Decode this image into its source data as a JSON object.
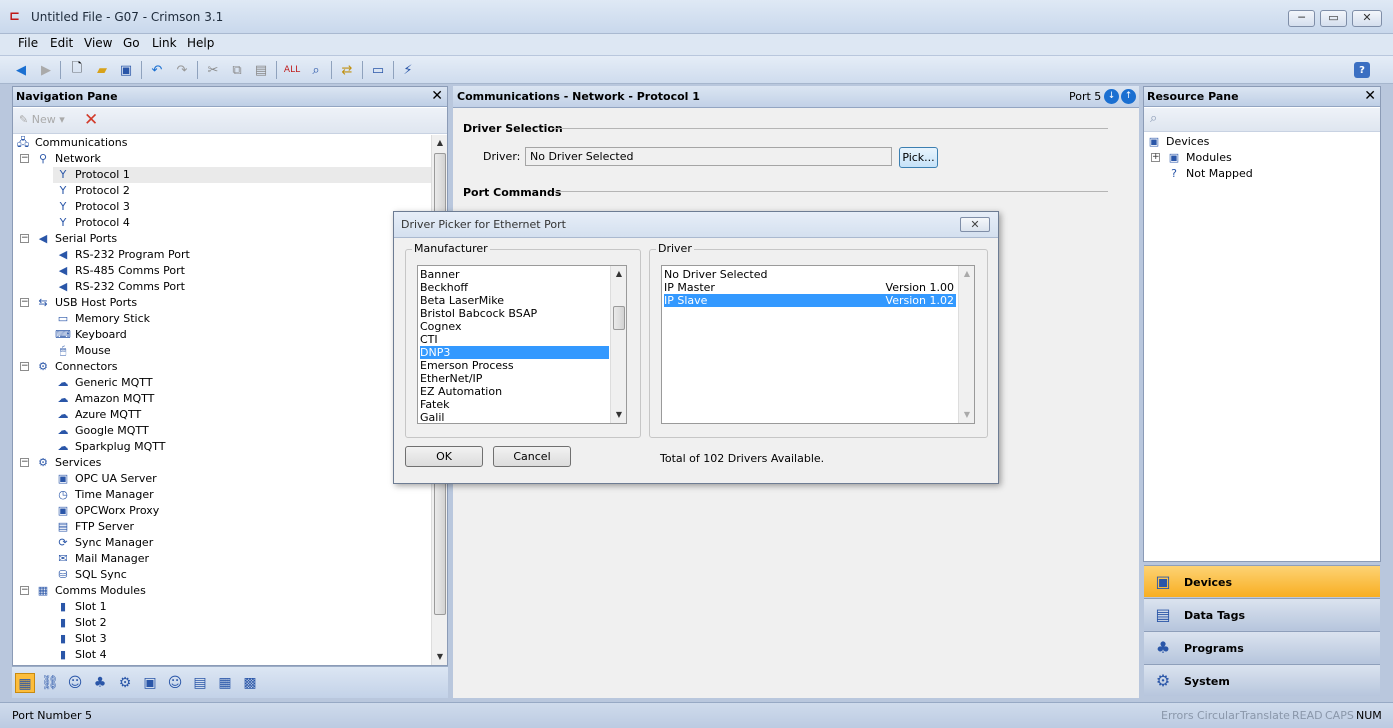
{
  "window": {
    "title": "Untitled File - G07 - Crimson 3.1",
    "min": "─",
    "max": "▭",
    "close": "✕"
  },
  "menu": [
    "File",
    "Edit",
    "View",
    "Go",
    "Link",
    "Help"
  ],
  "toolbar_icons": [
    "back-icon",
    "forward-icon",
    "new-file-icon",
    "open-folder-icon",
    "save-icon",
    "undo-icon",
    "redo-icon",
    "cut-icon",
    "copy-icon",
    "paste-icon",
    "find-all-icon",
    "find-icon",
    "link-icon",
    "monitor-icon",
    "wand-icon",
    "help-icon"
  ],
  "nav": {
    "title": "Navigation Pane",
    "new_label": "New ▾",
    "tree": [
      {
        "label": "Communications",
        "level": 0,
        "icon": "🖧"
      },
      {
        "label": "Network",
        "level": 1,
        "icon": "⚲",
        "exp": "−"
      },
      {
        "label": "Protocol 1",
        "level": 2,
        "icon": "Y",
        "sel": true
      },
      {
        "label": "Protocol 2",
        "level": 2,
        "icon": "Y"
      },
      {
        "label": "Protocol 3",
        "level": 2,
        "icon": "Y"
      },
      {
        "label": "Protocol 4",
        "level": 2,
        "icon": "Y"
      },
      {
        "label": "Serial Ports",
        "level": 1,
        "icon": "◀",
        "exp": "−"
      },
      {
        "label": "RS-232 Program Port",
        "level": 2,
        "icon": "◀"
      },
      {
        "label": "RS-485 Comms Port",
        "level": 2,
        "icon": "◀"
      },
      {
        "label": "RS-232 Comms Port",
        "level": 2,
        "icon": "◀"
      },
      {
        "label": "USB Host Ports",
        "level": 1,
        "icon": "⇆",
        "exp": "−"
      },
      {
        "label": "Memory Stick",
        "level": 2,
        "icon": "▭"
      },
      {
        "label": "Keyboard",
        "level": 2,
        "icon": "⌨"
      },
      {
        "label": "Mouse",
        "level": 2,
        "icon": "🖱"
      },
      {
        "label": "Connectors",
        "level": 1,
        "icon": "⚙",
        "exp": "−"
      },
      {
        "label": "Generic MQTT",
        "level": 2,
        "icon": "☁"
      },
      {
        "label": "Amazon MQTT",
        "level": 2,
        "icon": "☁"
      },
      {
        "label": "Azure MQTT",
        "level": 2,
        "icon": "☁"
      },
      {
        "label": "Google MQTT",
        "level": 2,
        "icon": "☁"
      },
      {
        "label": "Sparkplug MQTT",
        "level": 2,
        "icon": "☁"
      },
      {
        "label": "Services",
        "level": 1,
        "icon": "⚙",
        "exp": "−"
      },
      {
        "label": "OPC UA Server",
        "level": 2,
        "icon": "▣"
      },
      {
        "label": "Time Manager",
        "level": 2,
        "icon": "◷"
      },
      {
        "label": "OPCWorx Proxy",
        "level": 2,
        "icon": "▣"
      },
      {
        "label": "FTP Server",
        "level": 2,
        "icon": "▤"
      },
      {
        "label": "Sync Manager",
        "level": 2,
        "icon": "⟳"
      },
      {
        "label": "Mail Manager",
        "level": 2,
        "icon": "✉"
      },
      {
        "label": "SQL Sync",
        "level": 2,
        "icon": "⛁"
      },
      {
        "label": "Comms Modules",
        "level": 1,
        "icon": "▦",
        "exp": "−"
      },
      {
        "label": "Slot 1",
        "level": 2,
        "icon": "▮"
      },
      {
        "label": "Slot 2",
        "level": 2,
        "icon": "▮"
      },
      {
        "label": "Slot 3",
        "level": 2,
        "icon": "▮"
      },
      {
        "label": "Slot 4",
        "level": 2,
        "icon": "▮"
      }
    ],
    "bottom_icons": [
      "▦",
      "⛓",
      "☺",
      "♣",
      "⚙",
      "▣",
      "☺",
      "▤",
      "▦",
      "▩"
    ]
  },
  "center": {
    "title": "Communications - Network - Protocol 1",
    "port": "Port 5",
    "driver_selection": "Driver Selection",
    "driver_label": "Driver:",
    "driver_value": "No Driver Selected",
    "pick_label": "Pick...",
    "port_commands": "Port Commands"
  },
  "dialog": {
    "title": "Driver Picker for Ethernet Port",
    "close": "✕",
    "manufacturer_label": "Manufacturer",
    "driver_label": "Driver",
    "manufacturers": [
      "Banner",
      "Beckhoff",
      "Beta LaserMike",
      "Bristol Babcock BSAP",
      "Cognex",
      "CTI",
      "DNP3",
      "Emerson Process",
      "EtherNet/IP",
      "EZ Automation",
      "Fatek",
      "Galil"
    ],
    "selected_manufacturer": "DNP3",
    "drivers": [
      {
        "name": "No Driver Selected",
        "version": ""
      },
      {
        "name": "IP Master",
        "version": "Version 1.00"
      },
      {
        "name": "IP Slave",
        "version": "Version 1.02"
      }
    ],
    "selected_driver": "IP Slave",
    "ok_label": "OK",
    "cancel_label": "Cancel",
    "total_text": "Total of 102 Drivers Available."
  },
  "resource": {
    "title": "Resource Pane",
    "tree": [
      {
        "label": "Devices",
        "level": 0
      },
      {
        "label": "Modules",
        "level": 1,
        "exp": "+"
      },
      {
        "label": "Not Mapped",
        "level": 1
      }
    ],
    "nav_items": [
      {
        "label": "Devices",
        "icon": "▣",
        "active": true
      },
      {
        "label": "Data Tags",
        "icon": "▤"
      },
      {
        "label": "Programs",
        "icon": "♣"
      },
      {
        "label": "System",
        "icon": "⚙"
      }
    ]
  },
  "status": {
    "left": "Port Number 5",
    "indicators": [
      "Errors",
      "Circular",
      "Translate",
      "READ",
      "CAPS",
      "NUM"
    ]
  },
  "colors": {
    "accent": "#fdbd3b",
    "selection": "#3399ff"
  }
}
